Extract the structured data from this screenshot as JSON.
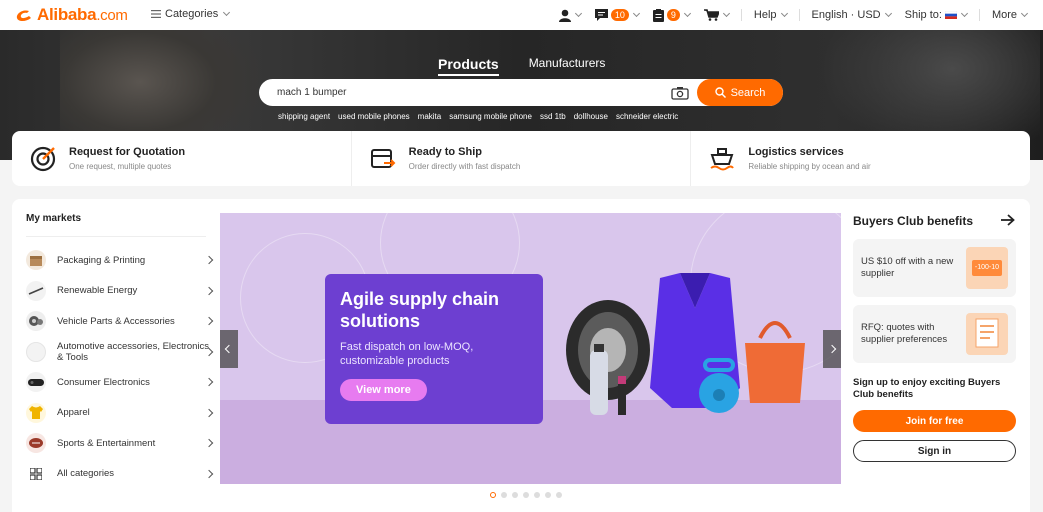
{
  "header": {
    "logo_text": "Alibaba",
    "logo_suffix": ".com",
    "categories_label": "Categories",
    "messages_count": "10",
    "orders_count": "9",
    "help_label": "Help",
    "language_label": "English · USD",
    "ship_to_label": "Ship to:",
    "more_label": "More"
  },
  "hero": {
    "tabs": [
      "Products",
      "Manufacturers"
    ],
    "search_query": "mach 1 bumper",
    "search_button": "Search",
    "suggestions": [
      "shipping agent",
      "used mobile phones",
      "makita",
      "samsung mobile phone",
      "ssd 1tb",
      "dollhouse",
      "schneider electric"
    ]
  },
  "services": [
    {
      "title": "Request for Quotation",
      "subtitle": "One request, multiple quotes",
      "icon": "target-icon"
    },
    {
      "title": "Ready to Ship",
      "subtitle": "Order directly with fast dispatch",
      "icon": "box-dispatch-icon"
    },
    {
      "title": "Logistics services",
      "subtitle": "Reliable shipping by ocean and air",
      "icon": "ship-icon"
    }
  ],
  "markets": {
    "title": "My markets",
    "items": [
      {
        "label": "Packaging & Printing",
        "icon": "package-icon"
      },
      {
        "label": "Renewable Energy",
        "icon": "energy-icon"
      },
      {
        "label": "Vehicle Parts & Accessories",
        "icon": "vehicle-parts-icon"
      },
      {
        "label": "Automotive accessories, Electronics & Tools",
        "icon": "automotive-icon"
      },
      {
        "label": "Consumer Electronics",
        "icon": "electronics-icon"
      },
      {
        "label": "Apparel",
        "icon": "apparel-icon"
      },
      {
        "label": "Sports & Entertainment",
        "icon": "sports-icon"
      },
      {
        "label": "All categories",
        "icon": "grid-icon"
      }
    ]
  },
  "banner": {
    "headline": "Agile supply chain solutions",
    "body": "Fast dispatch on low-MOQ, customizable products",
    "cta": "View more",
    "slides_total": 7,
    "active_slide": 1
  },
  "buyers_club": {
    "title": "Buyers Club benefits",
    "cards": [
      {
        "text": "US $10 off with a new supplier",
        "badge": "-100-10"
      },
      {
        "text": "RFQ: quotes with supplier preferences"
      }
    ],
    "note": "Sign up to enjoy exciting Buyers Club benefits",
    "join_button": "Join for free",
    "sign_in_button": "Sign in"
  },
  "colors": {
    "accent": "#ff6a00",
    "banner_card": "#6d3fd1",
    "banner_bg": "#d9c6ec"
  }
}
